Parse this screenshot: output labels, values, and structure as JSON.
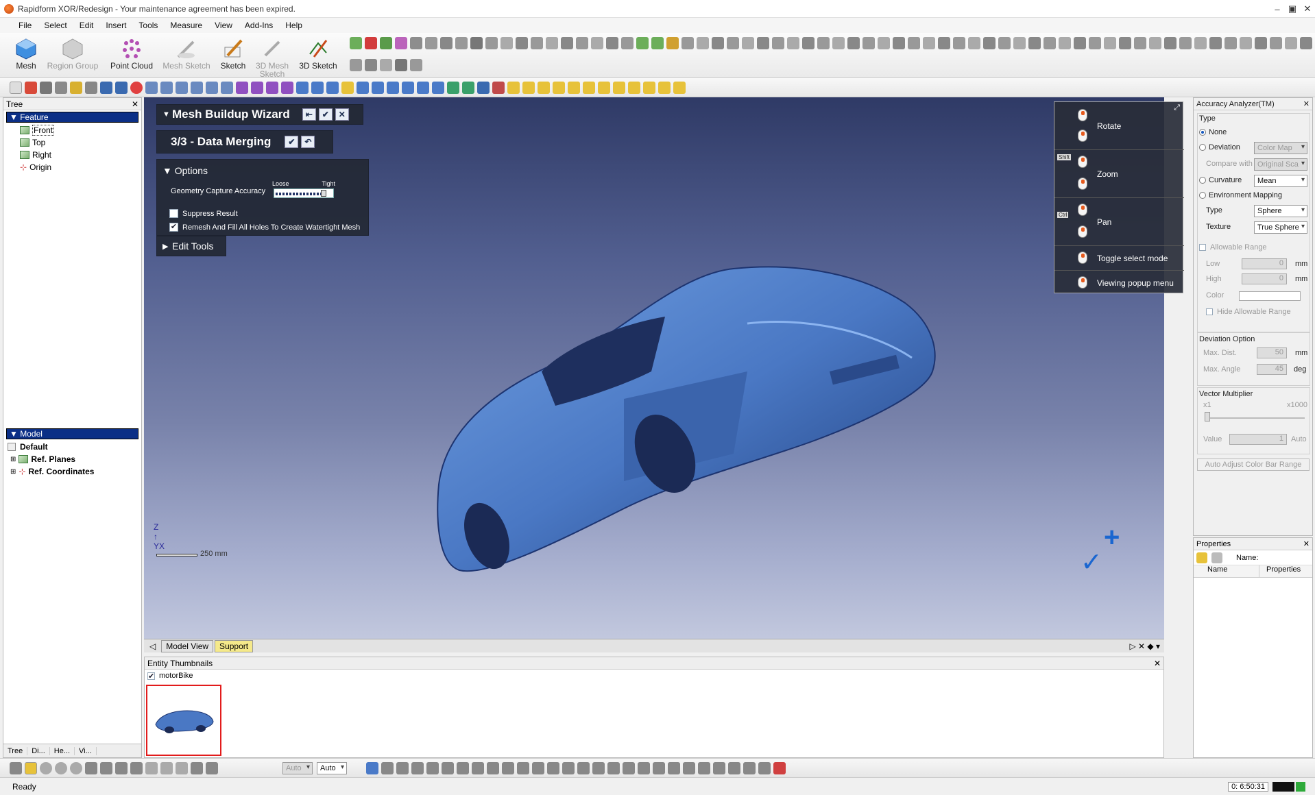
{
  "window": {
    "title": "Rapidform XOR/Redesign - Your maintenance agreement has been expired."
  },
  "menu": [
    "File",
    "Select",
    "Edit",
    "Insert",
    "Tools",
    "Measure",
    "View",
    "Add-Ins",
    "Help"
  ],
  "ribbon": {
    "buttons": [
      {
        "label": "Mesh",
        "enabled": true
      },
      {
        "label": "Region Group",
        "enabled": false
      },
      {
        "label": "Point Cloud",
        "enabled": true
      },
      {
        "label": "Mesh Sketch",
        "enabled": false
      },
      {
        "label": "Sketch",
        "enabled": true
      },
      {
        "label": "3D Mesh Sketch",
        "enabled": false
      },
      {
        "label": "3D Sketch",
        "enabled": true
      }
    ]
  },
  "tree": {
    "title": "Tree",
    "feature_header": "Feature",
    "feature_items": [
      "Front",
      "Top",
      "Right",
      "Origin"
    ],
    "model_header": "Model",
    "model_items": [
      "Default",
      "Ref. Planes",
      "Ref. Coordinates"
    ],
    "bottom_tabs": [
      "Tree",
      "Di...",
      "He...",
      "Vi..."
    ]
  },
  "wizard": {
    "title": "Mesh Buildup Wizard",
    "step": "3/3 - Data Merging",
    "options_label": "Options",
    "accuracy_label": "Geometry Capture Accuracy",
    "loose": "Loose",
    "tight": "Tight",
    "accuracy_level": 0.92,
    "suppress_label": "Suppress Result",
    "suppress_checked": false,
    "remesh_label": "Remesh And Fill All Holes To Create Watertight Mesh",
    "remesh_checked": true,
    "edit_tools": "Edit Tools"
  },
  "help_panel": {
    "rows": [
      {
        "label": "Rotate"
      },
      {
        "label": "Zoom",
        "key": "Shift"
      },
      {
        "label": "Pan",
        "key": "Ctrl"
      },
      {
        "label": "Toggle select mode"
      },
      {
        "label": "Viewing popup menu"
      }
    ]
  },
  "viewport": {
    "scale_label": "250 mm",
    "tabs": [
      "Model View",
      "Support"
    ],
    "active_tab": "Support"
  },
  "thumbnails": {
    "title": "Entity Thumbnails",
    "item": "motorBike",
    "checked": true
  },
  "accuracy_analyzer": {
    "title": "Accuracy Analyzer(TM)",
    "type_label": "Type",
    "none": "None",
    "deviation": "Deviation",
    "deviation_combo": "Color Map",
    "compare_with": "Compare with",
    "compare_combo": "Original Sca",
    "curvature": "Curvature",
    "curvature_combo": "Mean",
    "env_mapping": "Environment Mapping",
    "env_type_label": "Type",
    "env_type": "Sphere",
    "texture_label": "Texture",
    "texture": "True Sphere",
    "allowable_range": "Allowable Range",
    "low": "Low",
    "low_val": "0",
    "high": "High",
    "high_val": "0",
    "unit_mm": "mm",
    "color": "Color",
    "hide_allowable": "Hide Allowable Range",
    "deviation_option": "Deviation Option",
    "max_dist": "Max. Dist.",
    "max_dist_val": "50",
    "max_angle": "Max. Angle",
    "max_angle_val": "45",
    "unit_deg": "deg",
    "vector_multiplier": "Vector Multiplier",
    "x1": "x1",
    "x1000": "x1000",
    "value": "Value",
    "value_val": "1",
    "auto": "Auto",
    "auto_adjust": "Auto Adjust Color Bar Range"
  },
  "properties": {
    "title": "Properties",
    "name_label": "Name:",
    "col_name": "Name",
    "col_props": "Properties"
  },
  "status": {
    "text": "Ready",
    "time": "0: 6:50:31"
  },
  "bottom_combos": [
    "Auto",
    "Auto"
  ],
  "colors": {
    "selection_blue": "#0b2f86",
    "mesh_blue": "#4a78c4",
    "thumb_border": "#e21b1b"
  }
}
